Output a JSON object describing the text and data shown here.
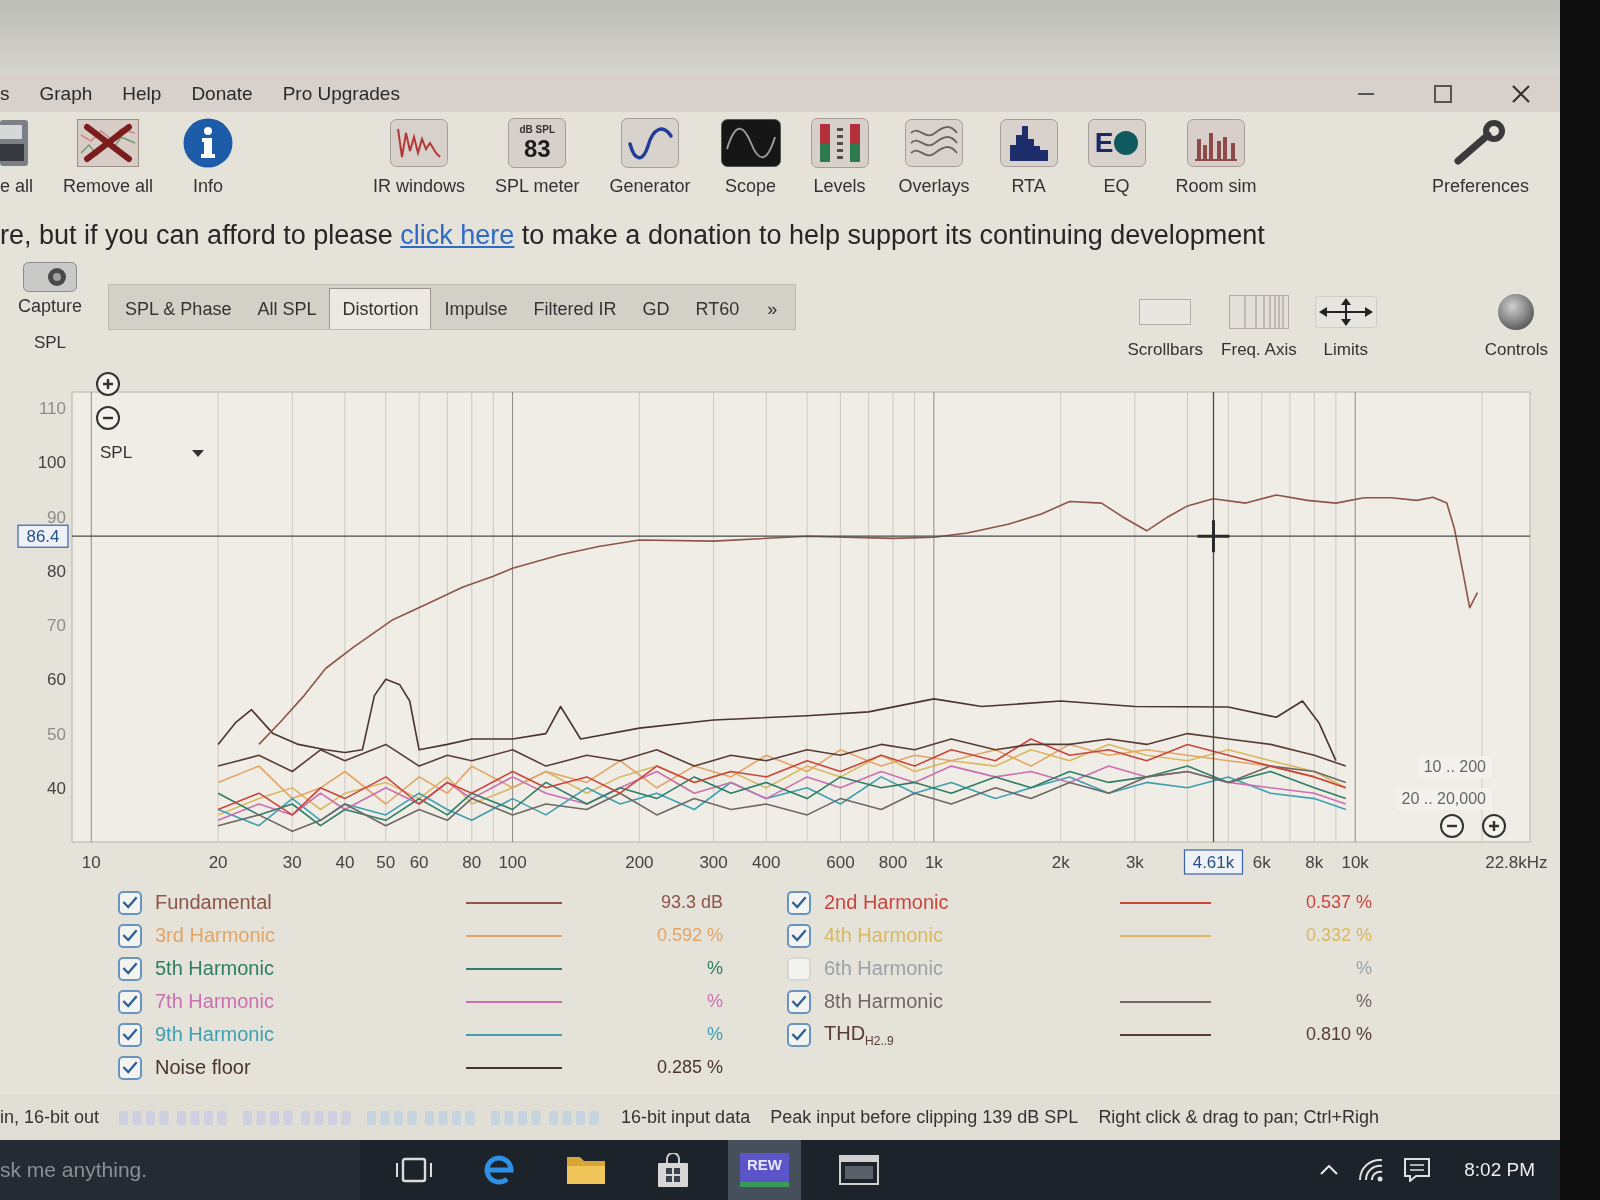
{
  "menu": [
    "s",
    "Graph",
    "Help",
    "Donate",
    "Pro Upgrades"
  ],
  "toolbar": [
    {
      "kind": "drive",
      "label": "e all"
    },
    {
      "kind": "remove",
      "label": "Remove all"
    },
    {
      "kind": "info",
      "label": "Info"
    },
    {
      "kind": "impulse",
      "label": "IR windows"
    },
    {
      "kind": "meter",
      "label": "SPL meter",
      "unit": "dB SPL",
      "reading": "83"
    },
    {
      "kind": "generator",
      "label": "Generator"
    },
    {
      "kind": "scope",
      "label": "Scope"
    },
    {
      "kind": "levels",
      "label": "Levels"
    },
    {
      "kind": "overlays",
      "label": "Overlays"
    },
    {
      "kind": "rta",
      "label": "RTA"
    },
    {
      "kind": "eq",
      "label": "EQ",
      "icon_text": "E"
    },
    {
      "kind": "roomsim",
      "label": "Room sim"
    },
    {
      "kind": "preferences",
      "label": "Preferences"
    }
  ],
  "banner": {
    "before": "re, but if you can afford to please",
    "link": "click here",
    "after": "to make a donation to help support its continuing development"
  },
  "capture": {
    "label": "Capture"
  },
  "tabs": [
    {
      "label": "SPL & Phase",
      "selected": false
    },
    {
      "label": "All SPL",
      "selected": false
    },
    {
      "label": "Distortion",
      "selected": true
    },
    {
      "label": "Impulse",
      "selected": false
    },
    {
      "label": "Filtered IR",
      "selected": false
    },
    {
      "label": "GD",
      "selected": false
    },
    {
      "label": "RT60",
      "selected": false
    }
  ],
  "tab_overflow": "»",
  "view_controls": [
    {
      "kind": "scrollbars",
      "label": "Scrollbars"
    },
    {
      "kind": "freq_axis",
      "label": "Freq. Axis"
    },
    {
      "kind": "limits",
      "label": "Limits"
    },
    {
      "kind": "controls",
      "label": "Controls"
    }
  ],
  "graph": {
    "selector": "SPL",
    "range_labels": [
      "10 .. 200",
      "20 .. 20,000"
    ],
    "chart_data": [
      {
        "type": "line",
        "ylabel": "SPL",
        "xlabel": "Hz",
        "log": "x",
        "grid": "x",
        "xlim": [
          9,
          26000
        ],
        "ylim": [
          30,
          113
        ],
        "xticks": [
          10,
          20,
          30,
          40,
          50,
          60,
          80,
          100,
          200,
          300,
          400,
          600,
          800,
          {
            "value": 1000,
            "label": "1k"
          },
          {
            "value": 2000,
            "label": "2k"
          },
          {
            "value": 3000,
            "label": "3k"
          },
          {
            "value": 6000,
            "label": "6k"
          },
          {
            "value": 8000,
            "label": "8k"
          },
          {
            "value": 10000,
            "label": "10k"
          },
          {
            "value": 22800,
            "label": "22.8k"
          }
        ],
        "yticks": [
          40,
          50,
          60,
          70,
          80,
          90,
          100,
          110
        ],
        "ref_lines": [
          {
            "axis": "y",
            "value": 86.4,
            "label": "86.4",
            "color": "#4a4a4a"
          },
          {
            "axis": "x",
            "value": 4610,
            "label": "4.61k",
            "color": "#4a4a4a"
          }
        ],
        "x": [
          20,
          25,
          30,
          35,
          40,
          50,
          60,
          70,
          80,
          100,
          120,
          150,
          180,
          220,
          270,
          330,
          400,
          500,
          600,
          750,
          900,
          1100,
          1400,
          1700,
          2100,
          2600,
          3200,
          4000,
          5000,
          6300,
          8000,
          9500
        ],
        "series": [
          {
            "color": "#d9b860",
            "values": [
              35,
              38,
              40,
              36,
              39,
              41,
              38,
              42,
              37,
              40,
              43,
              39,
              42,
              44,
              41,
              43,
              40,
              44,
              42,
              46,
              43,
              45,
              44,
              47,
              45,
              48,
              46,
              45,
              47,
              45,
              43,
              40
            ]
          },
          {
            "color": "#e3a465",
            "values": [
              41,
              44,
              38,
              40,
              43,
              37,
              42,
              39,
              44,
              40,
              43,
              41,
              45,
              40,
              44,
              42,
              46,
              43,
              47,
              44,
              46,
              45,
              47,
              44,
              48,
              46,
              47,
              46,
              45,
              44,
              42,
              40
            ]
          },
          {
            "color": "#3f9fb0",
            "values": [
              36,
              33,
              38,
              34,
              37,
              35,
              39,
              36,
              34,
              38,
              35,
              40,
              37,
              39,
              36,
              41,
              38,
              40,
              37,
              42,
              39,
              41,
              38,
              40,
              42,
              39,
              41,
              40,
              42,
              39,
              38,
              36
            ]
          },
          {
            "color": "#cc6fb0",
            "values": [
              34,
              37,
              35,
              39,
              36,
              40,
              37,
              41,
              38,
              42,
              39,
              37,
              40,
              43,
              39,
              41,
              38,
              42,
              40,
              43,
              41,
              44,
              42,
              43,
              41,
              44,
              42,
              43,
              41,
              40,
              39,
              37
            ]
          },
          {
            "color": "#2e7d64",
            "values": [
              39,
              35,
              37,
              33,
              36,
              34,
              38,
              35,
              39,
              36,
              41,
              37,
              40,
              38,
              42,
              39,
              41,
              38,
              42,
              40,
              41,
              39,
              42,
              40,
              43,
              41,
              42,
              44,
              41,
              43,
              40,
              38
            ]
          },
          {
            "color": "#6f6764",
            "values": [
              33,
              35,
              32,
              34,
              37,
              33,
              36,
              34,
              38,
              35,
              37,
              36,
              39,
              35,
              38,
              36,
              37,
              35,
              38,
              36,
              39,
              37,
              40,
              38,
              41,
              39,
              42,
              43,
              41,
              44,
              43,
              41
            ]
          },
          {
            "color": "#c9463d",
            "values": [
              36,
              39,
              35,
              40,
              38,
              42,
              37,
              41,
              39,
              43,
              40,
              42,
              39,
              44,
              41,
              43,
              42,
              45,
              43,
              46,
              44,
              47,
              45,
              49,
              46,
              47,
              45,
              48,
              46,
              44,
              42,
              40
            ]
          },
          {
            "color": "#5a3c36",
            "values": [
              44,
              46,
              43,
              47,
              45,
              48,
              44,
              46,
              45,
              47,
              44,
              46,
              45,
              47,
              44,
              46,
              45,
              47,
              46,
              48,
              47,
              49,
              47,
              48,
              48,
              49,
              48,
              50,
              49,
              48,
              46,
              44
            ]
          },
          {
            "color": "#4a3430",
            "x": [
              20,
              22,
              24,
              27,
              31,
              36,
              40,
              44,
              47,
              50,
              54,
              57,
              60,
              70,
              80,
              100,
              120,
              130,
              145,
              200,
              300,
              500,
              700,
              1000,
              1300,
              2000,
              3000,
              5000,
              6500,
              7500,
              8200,
              9000
            ],
            "values": [
              48,
              52,
              54.4,
              50,
              48,
              47,
              46.5,
              47,
              57,
              60,
              59,
              56,
              47,
              48,
              49,
              49,
              50,
              55,
              49,
              51,
              52.5,
              53.3,
              54,
              56.4,
              55,
              56,
              55,
              54.9,
              53,
              56,
              52,
              45
            ]
          },
          {
            "color": "#8c5548",
            "x": [
              25,
              28,
              32,
              36,
              42,
              52,
              63,
              76,
              90,
              100,
              130,
              160,
              200,
              300,
              500,
              800,
              1000,
              1200,
              1500,
              1800,
              2100,
              2500,
              2800,
              3200,
              3600,
              4000,
              4600,
              5500,
              6500,
              7700,
              9000,
              10500,
              12200,
              14000,
              15300,
              16500,
              17200,
              18000,
              18700,
              19500
            ],
            "values": [
              48,
              52,
              57,
              62,
              66,
              71,
              74,
              77,
              79,
              80.5,
              83,
              84.5,
              85.7,
              85.5,
              86.4,
              86,
              86.2,
              87,
              88.6,
              90.5,
              92.8,
              92.5,
              90,
              87.4,
              90,
              92,
              93.3,
              92.5,
              94,
              93,
              92.5,
              93.5,
              93.5,
              93,
              93.6,
              92.5,
              87.8,
              80,
              73.2,
              76
            ]
          }
        ]
      }
    ],
    "legend_columns": [
      {
        "items": [
          {
            "label": "Fundamental",
            "checked": true,
            "reading": "93.3 dB",
            "color": "#8c5548"
          },
          {
            "label": "3rd Harmonic",
            "checked": true,
            "reading": "0.592 %",
            "color": "#e3a465"
          },
          {
            "label": "5th Harmonic",
            "checked": true,
            "reading": "%",
            "color": "#2e7d64"
          },
          {
            "label": "7th Harmonic",
            "checked": true,
            "reading": "%",
            "color": "#cc6fb0"
          },
          {
            "label": "9th Harmonic",
            "checked": true,
            "reading": "%",
            "color": "#3f9fb0"
          },
          {
            "label": "Noise floor",
            "checked": true,
            "reading": "0.285 %",
            "color": "#4a3430"
          }
        ]
      },
      {
        "items": [
          {
            "label": "2nd Harmonic",
            "checked": true,
            "reading": "0.537 %",
            "color": "#c9463d"
          },
          {
            "label": "4th Harmonic",
            "checked": true,
            "reading": "0.332 %",
            "color": "#d9b860"
          },
          {
            "label": "6th Harmonic",
            "checked": false,
            "reading": "%",
            "color": "#9aa2a8"
          },
          {
            "label": "8th Harmonic",
            "checked": true,
            "reading": "%",
            "color": "#6f6764"
          },
          {
            "label": "THD$_{H2..9}$",
            "checked": true,
            "reading": "0.810 %",
            "color": "#5a3c36"
          }
        ]
      }
    ]
  },
  "status_bar": {
    "mode": "in, 16-bit out",
    "messages": [
      "16-bit input data",
      "Peak input before clipping 139 dB SPL",
      "Right click & drag to pan; Ctrl+Righ"
    ]
  },
  "taskbar": {
    "search": {
      "placeholder": "sk me anything."
    },
    "apps": [
      {
        "kind": "taskview",
        "selected": false
      },
      {
        "kind": "browser",
        "selected": false
      },
      {
        "kind": "folder",
        "selected": false
      },
      {
        "kind": "store",
        "selected": false
      },
      {
        "kind": "app",
        "label": "REW",
        "selected": true
      },
      {
        "kind": "window",
        "selected": false
      }
    ],
    "clock": "8:02 PM"
  }
}
